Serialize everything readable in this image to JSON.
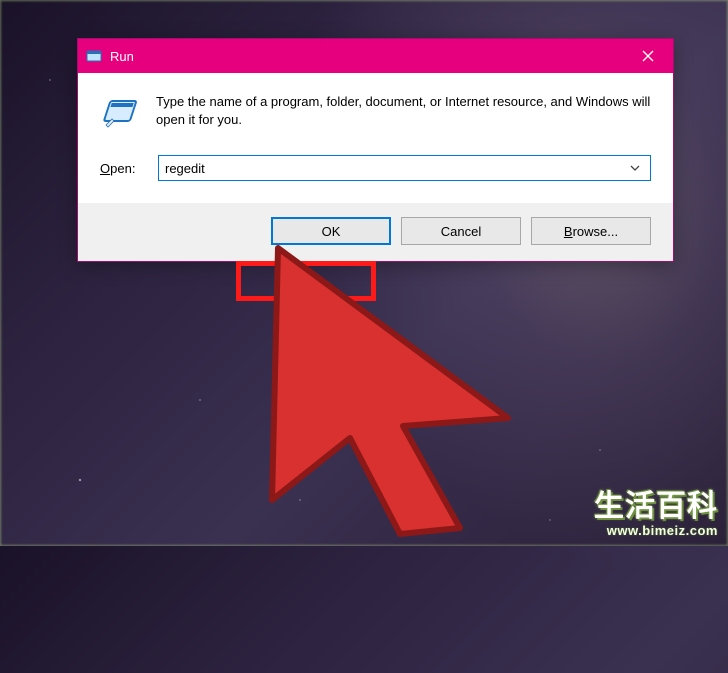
{
  "dialog": {
    "title": "Run",
    "description": "Type the name of a program, folder, document, or Internet resource, and Windows will open it for you.",
    "open_label_pre": "O",
    "open_label_post": "pen:",
    "input_value": "regedit",
    "buttons": {
      "ok": "OK",
      "cancel": "Cancel",
      "browse_pre": "B",
      "browse_post": "rowse..."
    }
  },
  "watermark": {
    "title": "生活百科",
    "url": "www.bimeiz.com"
  }
}
